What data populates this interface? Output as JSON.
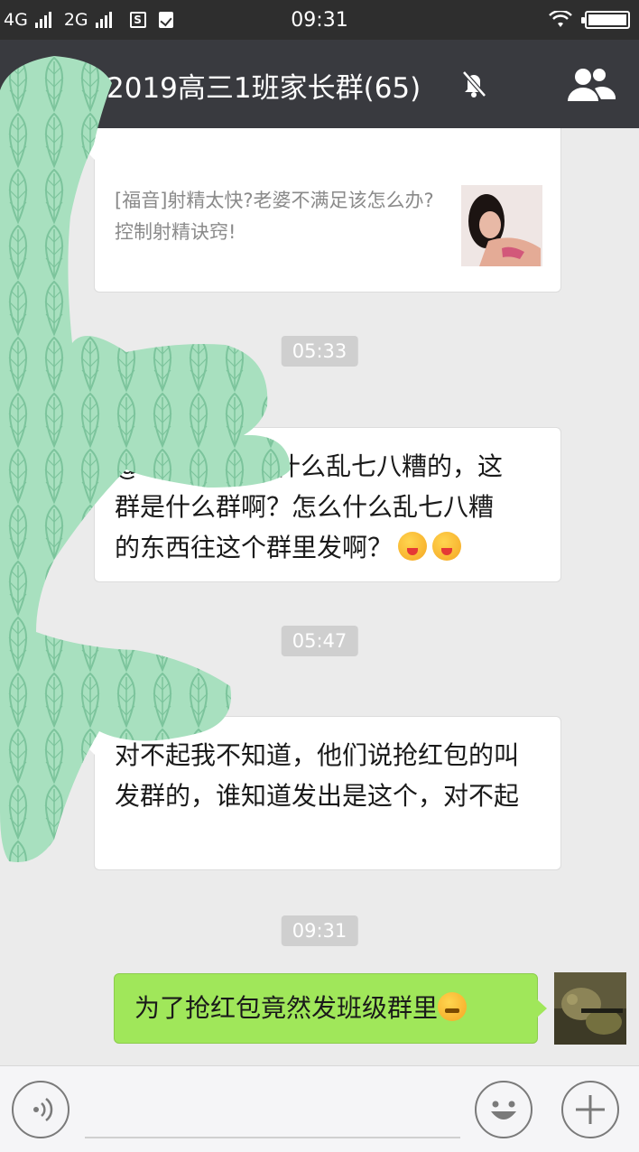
{
  "status_bar": {
    "network1": "4G",
    "network2": "2G",
    "sim_icon": "S",
    "time": "09:31"
  },
  "header": {
    "title": "2019高三1班家长群(65)",
    "back_icon": "back-arrow-icon",
    "mute_icon": "bell-off-icon",
    "members_icon": "group-members-icon"
  },
  "messages": {
    "link_card": {
      "description": "[福音]射精太快?老婆不满足该怎么办?控制射精诀窍!"
    },
    "timestamps": [
      "05:33",
      "05:47",
      "09:31"
    ],
    "msg1": {
      "line1": "@",
      "line1_rest": "什么乱七八糟的，这",
      "line2": "群是什么群啊？怎么什么乱七八糟",
      "line3": "的东西往这个群里发啊？"
    },
    "msg2": {
      "text": "对不起我不知道，他们说抢红包的叫发群的，谁知道发出是这个，对不起"
    },
    "sent": {
      "text": "为了抢红包竟然发班级群里"
    }
  },
  "input_bar": {
    "voice_icon": "voice-icon",
    "emoji_icon": "emoji-icon",
    "plus_icon": "plus-icon",
    "input_value": ""
  },
  "colors": {
    "status_bar": "#2e2e2e",
    "title_bar": "#393a3f",
    "chat_background": "#ebebeb",
    "sent_bubble": "#a0e75a",
    "timestamp_bg": "#cfcfcf",
    "redaction": "#a8e0bf"
  }
}
